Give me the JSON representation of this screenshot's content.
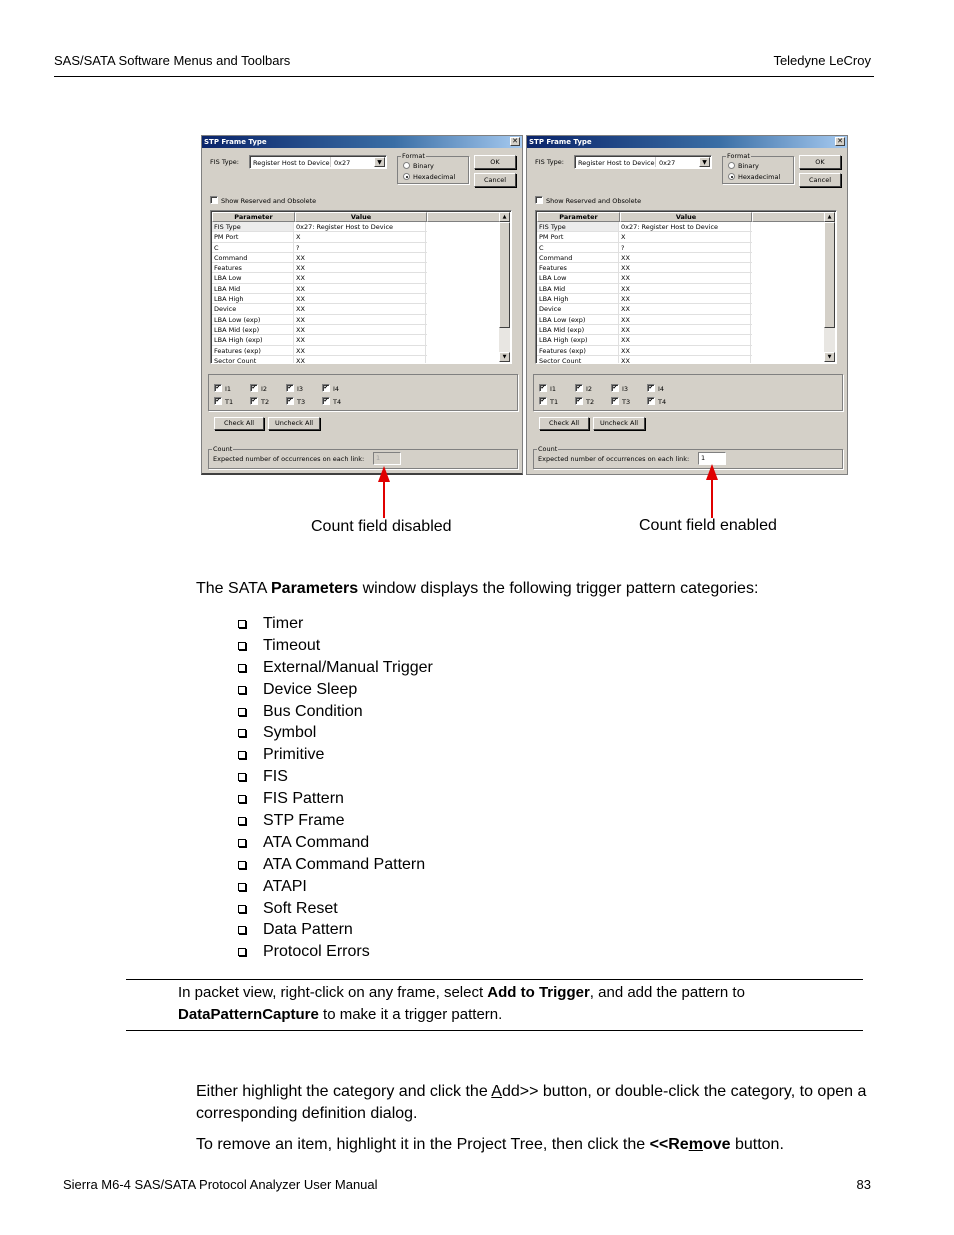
{
  "header": {
    "left": "SAS/SATA Software Menus and Toolbars",
    "right": "Teledyne LeCroy"
  },
  "dialogs": [
    {
      "title": "STP Frame Type",
      "fis_type_label": "FIS Type:",
      "fis_type_value": "Register Host to Device",
      "fis_type_code": "0x27",
      "format": {
        "legend": "Format",
        "options": [
          "Binary",
          "Hexadecimal"
        ],
        "selected": "Hexadecimal"
      },
      "ok_label": "OK",
      "cancel_label": "Cancel",
      "show_reserved_label": "Show Reserved and Obsolete",
      "show_reserved_checked": false,
      "columns": [
        "Parameter",
        "Value"
      ],
      "rows": [
        [
          "FIS Type",
          "0x27: Register Host to Device"
        ],
        [
          "PM Port",
          "X"
        ],
        [
          "C",
          "?"
        ],
        [
          "Command",
          "XX"
        ],
        [
          "Features",
          "XX"
        ],
        [
          "LBA Low",
          "XX"
        ],
        [
          "LBA Mid",
          "XX"
        ],
        [
          "LBA High",
          "XX"
        ],
        [
          "Device",
          "XX"
        ],
        [
          "LBA Low (exp)",
          "XX"
        ],
        [
          "LBA Mid (exp)",
          "XX"
        ],
        [
          "LBA High (exp)",
          "XX"
        ],
        [
          "Features (exp)",
          "XX"
        ],
        [
          "Sector Count",
          "XX"
        ]
      ],
      "links": [
        "I1",
        "I2",
        "I3",
        "I4",
        "T1",
        "T2",
        "T3",
        "T4"
      ],
      "check_all_label": "Check All",
      "uncheck_all_label": "Uncheck All",
      "count_legend": "Count",
      "count_label": "Expected number of occurrences on each link:",
      "count_value": "1",
      "count_enabled": false
    },
    {
      "title": "STP Frame Type",
      "fis_type_label": "FIS Type:",
      "fis_type_value": "Register Host to Device",
      "fis_type_code": "0x27",
      "format": {
        "legend": "Format",
        "options": [
          "Binary",
          "Hexadecimal"
        ],
        "selected": "Hexadecimal"
      },
      "ok_label": "OK",
      "cancel_label": "Cancel",
      "show_reserved_label": "Show Reserved and Obsolete",
      "show_reserved_checked": false,
      "columns": [
        "Parameter",
        "Value"
      ],
      "rows": [
        [
          "FIS Type",
          "0x27: Register Host to Device"
        ],
        [
          "PM Port",
          "X"
        ],
        [
          "C",
          "?"
        ],
        [
          "Command",
          "XX"
        ],
        [
          "Features",
          "XX"
        ],
        [
          "LBA Low",
          "XX"
        ],
        [
          "LBA Mid",
          "XX"
        ],
        [
          "LBA High",
          "XX"
        ],
        [
          "Device",
          "XX"
        ],
        [
          "LBA Low (exp)",
          "XX"
        ],
        [
          "LBA Mid (exp)",
          "XX"
        ],
        [
          "LBA High (exp)",
          "XX"
        ],
        [
          "Features (exp)",
          "XX"
        ],
        [
          "Sector Count",
          "XX"
        ]
      ],
      "links": [
        "I1",
        "I2",
        "I3",
        "I4",
        "T1",
        "T2",
        "T3",
        "T4"
      ],
      "check_all_label": "Check All",
      "uncheck_all_label": "Uncheck All",
      "count_legend": "Count",
      "count_label": "Expected number of occurrences on each link:",
      "count_value": "1",
      "count_enabled": true
    }
  ],
  "captions": {
    "left": "Count field disabled",
    "right": "Count field enabled"
  },
  "arrow_color": "#e00000",
  "intro": {
    "pre": "The SATA ",
    "bold": "Parameters",
    "post": " window displays the following trigger pattern categories:"
  },
  "categories": [
    "Timer",
    "Timeout",
    "External/Manual Trigger",
    "Device Sleep",
    "Bus Condition",
    "Symbol",
    "Primitive",
    "FIS",
    "FIS Pattern",
    "STP Frame",
    "ATA Command",
    "ATA Command Pattern",
    "ATAPI",
    "Soft Reset",
    "Data Pattern",
    "Protocol Errors"
  ],
  "note": {
    "line1_pre": "In packet view, right-click on any frame, select ",
    "line1_bold": "Add to Trigger",
    "line1_post": ", and add the pattern to",
    "line2_bold": "DataPatternCapture",
    "line2_post": " to make it a trigger pattern."
  },
  "para1": {
    "pre": "Either highlight the category and click the ",
    "add_underlined": "A",
    "add_rest": "dd>>",
    "post": " button, or double-click the category, to open a corresponding definition dialog."
  },
  "para2": {
    "pre": "To remove an item, highlight it in the Project Tree, then click the ",
    "bold_a": "<<Re",
    "bold_u": "m",
    "bold_b": "ove",
    "post": " button."
  },
  "footer": {
    "left": "Sierra M6-4 SAS/SATA Protocol Analyzer User Manual",
    "page": "83"
  }
}
